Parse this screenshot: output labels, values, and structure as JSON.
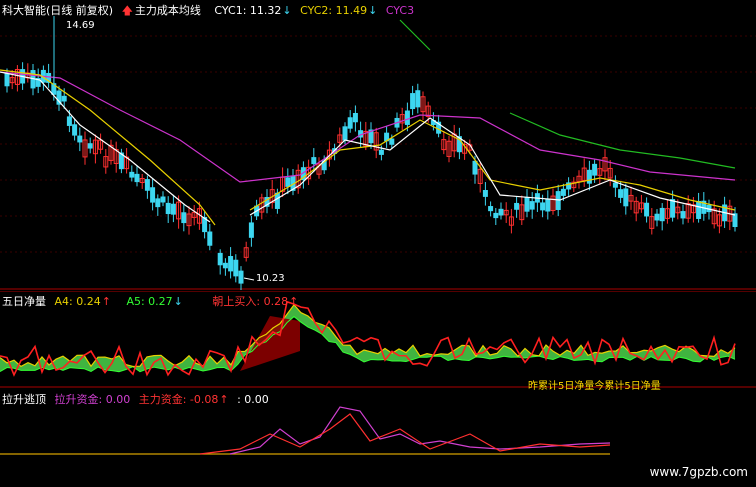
{
  "main": {
    "title": "科大智能(日线 前复权)",
    "indicator": "主力成本均线",
    "cyc1_label": "CYC1: 11.32",
    "cyc1_arrow": "↓",
    "cyc2_label": "CYC2: 11.49",
    "cyc2_arrow": "↓",
    "cyc3_label": "CYC3",
    "high_label": "14.69",
    "low_label": "10.23"
  },
  "mid": {
    "title": "五日净量",
    "a4": "A4: 0.24",
    "a4_arrow": "↑",
    "a5": "A5: 0.27",
    "a5_arrow": "↓",
    "buy": "朝上买入: 0.28",
    "buy_arrow": "↑",
    "overlay_text": "昨累计5日净量今累计5日净量"
  },
  "bottom": {
    "title": "拉升逃顶",
    "lift": "拉升资金: 0.00",
    "main_fund": "主力资金: -0.08",
    "main_fund_arrow": "↑",
    "extra": ": 0.00"
  },
  "watermark": "www.7gpzb.com",
  "colors": {
    "up": "#ff3030",
    "down": "#3dd6f0",
    "ma_white": "#ffffff",
    "ma_yellow": "#e8d000",
    "ma_purple": "#cc33cc",
    "ma_green": "#22bb22",
    "divider": "#aa0000"
  }
}
